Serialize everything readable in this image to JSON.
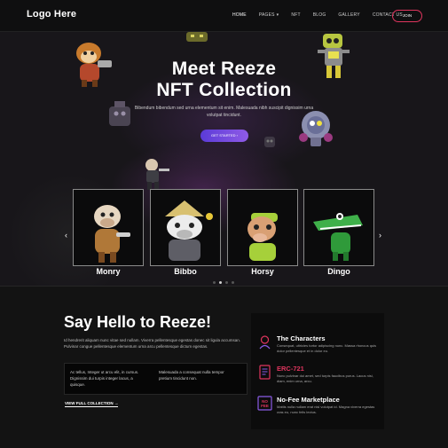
{
  "header": {
    "logo": "Logo Here",
    "nav": [
      {
        "label": "HOME",
        "active": true
      },
      {
        "label": "PAGES",
        "dropdown": true
      },
      {
        "label": "NFT"
      },
      {
        "label": "BLOG"
      },
      {
        "label": "GALLERY"
      },
      {
        "label": "CONTACT US"
      }
    ],
    "join_label": "JOIN"
  },
  "hero": {
    "title_line1": "Meet Reeze",
    "title_line2": "NFT Collection",
    "subtitle": "Bibendum bibendum sed urna elementum sit enim. Malesuada nibh suscipit dignissim urna volutpat tincidunt.",
    "cta_label": "GET STARTED",
    "cta_arrow": "›"
  },
  "carousel": {
    "prev_arrow": "‹",
    "next_arrow": "›",
    "cards": [
      {
        "name": "Monry"
      },
      {
        "name": "Bibbo"
      },
      {
        "name": "Horsy"
      },
      {
        "name": "Dingo"
      }
    ],
    "dots_total": 4,
    "active_dot": 1
  },
  "about": {
    "title": "Say Hello to Reeze!",
    "paragraph": "Id hendrerit aliquam nunc vitae sed nullam. Viverra pellentesque egestas donec sit ligula accumsan. Pulvinar congue pellentesque elementum urna arcu pellentesque dictum egestas.",
    "info_left": "Ac tellus, Integer ut arcu elit, in cursus. Dignissim dui turpis integer lacus, a quisque.",
    "info_right": "Malesuada a consequat nulla tempor pretium tincidunt non.",
    "view_link": "VIEW FULL COLLECTION",
    "view_arrow": "→"
  },
  "features": [
    {
      "title": "The Characters",
      "desc": "Consequat, ultricies tortor adipiscing nunc. Massa rhoncus quis dolor pellentesque et in dolor eu.",
      "icon": "characters-icon",
      "pink": false
    },
    {
      "title": "ERC-721",
      "desc": "Nunc pulvinar dui amet, sed turpis faucibus purus. Lacus nisi, diam, enim urna, arcu.",
      "icon": "contract-icon",
      "pink": true
    },
    {
      "title": "No-Fee Marketplace",
      "desc": "Mattis nulla nullam erat nisl volutpat id. Magna viverra egestas cras eu, nunc felis lectus.",
      "icon": "no-fee-icon",
      "icon_text": "NO FEE",
      "pink": false
    }
  ],
  "colors": {
    "accent_pink": "#e0355e",
    "accent_purple": "#7a4be0",
    "background": "#141414"
  }
}
